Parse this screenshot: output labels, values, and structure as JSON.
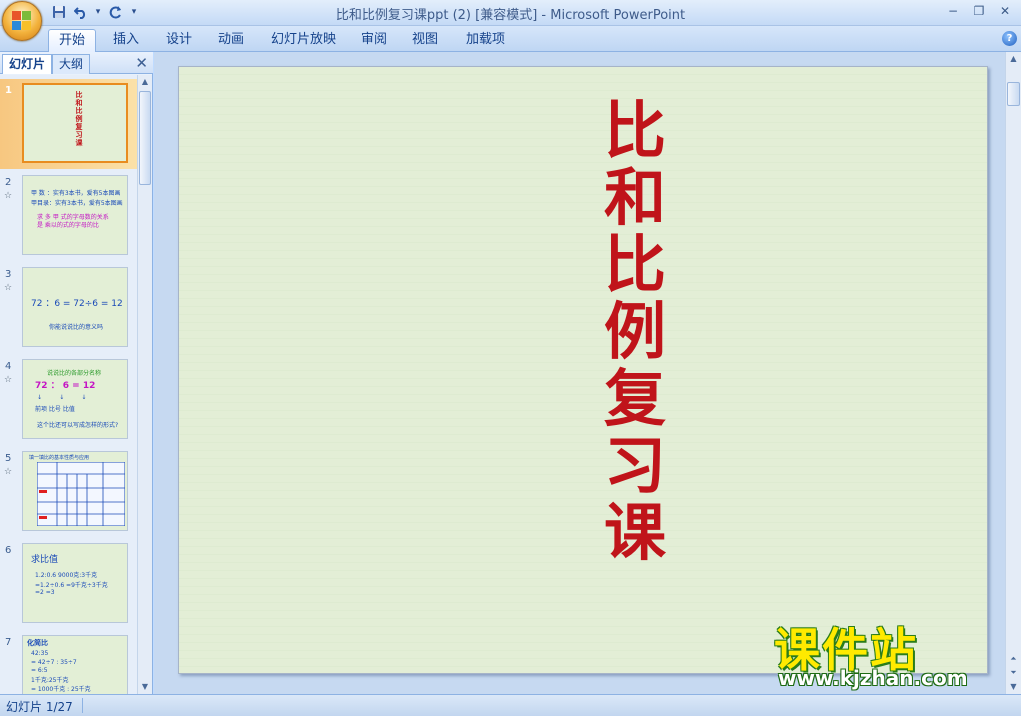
{
  "window": {
    "title": "比和比例复习课ppt (2) [兼容模式] - Microsoft PowerPoint",
    "minimize": "−",
    "restore": "❐",
    "close": "✕"
  },
  "quick_access": [
    {
      "name": "save-icon",
      "glyph": "💾"
    },
    {
      "name": "undo-icon",
      "glyph": "↶"
    },
    {
      "name": "undo-dropdown-icon",
      "glyph": "▾"
    },
    {
      "name": "redo-icon",
      "glyph": "↻"
    },
    {
      "name": "customize-qat-icon",
      "glyph": "▾"
    }
  ],
  "ribbon": {
    "tabs": [
      "开始",
      "插入",
      "设计",
      "动画",
      "幻灯片放映",
      "审阅",
      "视图",
      "加载项"
    ],
    "active_tab": "开始",
    "help": "?"
  },
  "left_pane": {
    "tabs": [
      "幻灯片",
      "大纲"
    ],
    "active_tab": "幻灯片",
    "close": "✕",
    "slides": [
      {
        "number": "1",
        "selected": true,
        "lines": [
          "比",
          "和",
          "比",
          "例",
          "复",
          "习",
          "课"
        ]
      },
      {
        "number": "2",
        "animated": true,
        "lines": [
          "甲 数 ：实有3本书，爱有5本图画",
          "甲目录：实有3本书，爱有5本图画",
          "求 多 甲 式的字母数的关系",
          "是 乘以的式的字母的比"
        ]
      },
      {
        "number": "3",
        "animated": true,
        "lines": [
          "72 ：6 = 72÷6 = 12",
          "你能说说比的意义吗"
        ]
      },
      {
        "number": "4",
        "animated": true,
        "lines": [
          "说说比的各部分名称",
          "72  ：  6  =  12",
          "前项   比号   比值",
          "这个比还可以写成怎样的形式?"
        ]
      },
      {
        "number": "5",
        "animated": true,
        "lines": [
          "填一填比的基本性质与应用"
        ]
      },
      {
        "number": "6",
        "animated": false,
        "lines": [
          "求比值",
          "1.2:0.6       9000克:3千克",
          "=1.2÷0.6    =9千克÷3千克",
          "=2               =3"
        ]
      },
      {
        "number": "7",
        "animated": false,
        "lines": [
          "化简比",
          "42:35",
          "= 42÷7 : 35÷7",
          "= 6:5",
          "1千克:25千克",
          "= 1000千克 : 25千克"
        ]
      }
    ],
    "animation_glyph": "☆"
  },
  "main_slide": {
    "title": "比和比例复习课"
  },
  "watermark": {
    "big": "课件站",
    "url": "www.kjzhan.com"
  },
  "status_bar": {
    "slide_indicator": "幻灯片 1/27"
  },
  "colors": {
    "title_red": "#c0141a",
    "slide_bg": "#e3eed6",
    "ribbon_blue": "#15428b"
  }
}
